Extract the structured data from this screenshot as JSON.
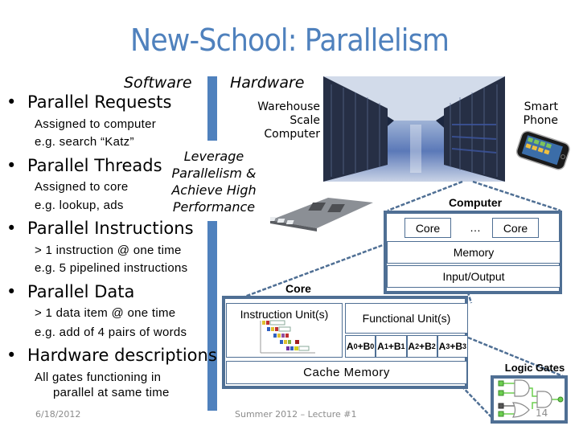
{
  "slide": {
    "title": "New-School: Parallelism",
    "software_label": "Software",
    "hardware_label": "Hardware",
    "leverage_text": [
      "Leverage",
      "Parallelism &",
      "Achieve High",
      "Performance"
    ],
    "accent_color": "#4f81bd",
    "border_color": "#4f6f94"
  },
  "bullets": [
    {
      "heading": "Parallel Requests",
      "details": [
        "Assigned to computer",
        "e.g. search “Katz”"
      ]
    },
    {
      "heading": "Parallel Threads",
      "details": [
        "Assigned to core",
        "e.g. lookup, ads"
      ]
    },
    {
      "heading": "Parallel Instructions",
      "details": [
        "> 1 instruction @ one time",
        "e.g. 5 pipelined instructions"
      ]
    },
    {
      "heading": "Parallel Data",
      "details": [
        "> 1 data item @ one time",
        "e.g. add of 4 pairs of words"
      ]
    },
    {
      "heading": "Hardware descriptions",
      "details": [
        "All gates functioning in",
        "parallel at same time"
      ]
    }
  ],
  "hardware": {
    "warehouse_label": [
      "Warehouse",
      "Scale",
      "Computer"
    ],
    "smartphone_label": [
      "Smart",
      "Phone"
    ],
    "computer": {
      "title": "Computer",
      "core_left": "Core",
      "ellipsis": "…",
      "core_right": "Core",
      "memory": "Memory",
      "io": "Input/Output"
    },
    "core": {
      "title": "Core",
      "instruction_unit": "Instruction Unit(s)",
      "functional_unit": "Functional Unit(s)",
      "adders": [
        {
          "a": "A",
          "ai": "0",
          "b": "B",
          "bi": "0"
        },
        {
          "a": "A",
          "ai": "1",
          "b": "B",
          "bi": "1"
        },
        {
          "a": "A",
          "ai": "2",
          "b": "B",
          "bi": "2"
        },
        {
          "a": "A",
          "ai": "3",
          "b": "B",
          "bi": "3"
        }
      ],
      "cache": "Cache Memory"
    },
    "logic_gates": {
      "title": "Logic Gates"
    }
  },
  "footer": {
    "date": "6/18/2012",
    "lecture": "Summer 2012 – Lecture #1",
    "page": "14"
  }
}
